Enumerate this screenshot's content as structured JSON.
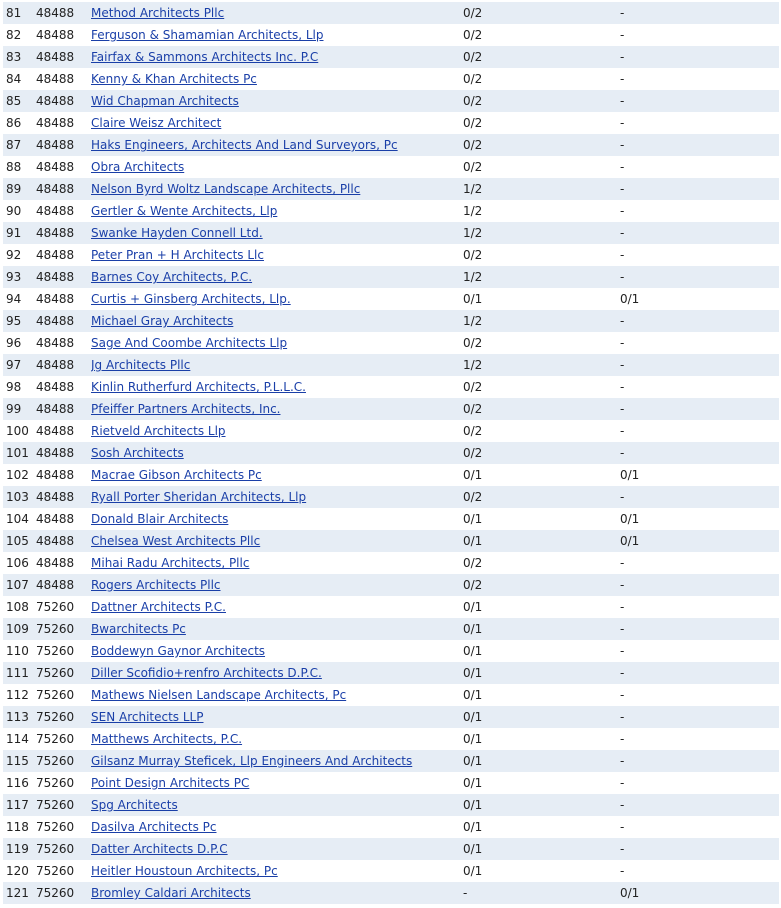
{
  "rows": [
    {
      "num": "81",
      "code": "48488",
      "name": "Method Architects Pllc",
      "a": "0/2",
      "b": "-"
    },
    {
      "num": "82",
      "code": "48488",
      "name": "Ferguson & Shamamian Architects, Llp",
      "a": "0/2",
      "b": "-"
    },
    {
      "num": "83",
      "code": "48488",
      "name": "Fairfax & Sammons Architects Inc. P.C",
      "a": "0/2",
      "b": "-"
    },
    {
      "num": "84",
      "code": "48488",
      "name": "Kenny & Khan Architects Pc",
      "a": "0/2",
      "b": "-"
    },
    {
      "num": "85",
      "code": "48488",
      "name": "Wid Chapman Architects",
      "a": "0/2",
      "b": "-"
    },
    {
      "num": "86",
      "code": "48488",
      "name": "Claire Weisz Architect",
      "a": "0/2",
      "b": "-"
    },
    {
      "num": "87",
      "code": "48488",
      "name": "Haks Engineers, Architects And Land Surveyors, Pc",
      "a": "0/2",
      "b": "-"
    },
    {
      "num": "88",
      "code": "48488",
      "name": "Obra Architects",
      "a": "0/2",
      "b": "-"
    },
    {
      "num": "89",
      "code": "48488",
      "name": "Nelson Byrd Woltz Landscape Architects, Pllc",
      "a": "1/2",
      "b": "-"
    },
    {
      "num": "90",
      "code": "48488",
      "name": "Gertler & Wente Architects, Llp",
      "a": "1/2",
      "b": "-"
    },
    {
      "num": "91",
      "code": "48488",
      "name": "Swanke Hayden Connell Ltd.",
      "a": "1/2",
      "b": "-"
    },
    {
      "num": "92",
      "code": "48488",
      "name": "Peter Pran + H Architects Llc",
      "a": "0/2",
      "b": "-"
    },
    {
      "num": "93",
      "code": "48488",
      "name": "Barnes Coy Architects, P.C.",
      "a": "1/2",
      "b": "-"
    },
    {
      "num": "94",
      "code": "48488",
      "name": "Curtis + Ginsberg Architects, Llp.",
      "a": "0/1",
      "b": "0/1"
    },
    {
      "num": "95",
      "code": "48488",
      "name": "Michael Gray Architects",
      "a": "1/2",
      "b": "-"
    },
    {
      "num": "96",
      "code": "48488",
      "name": "Sage And Coombe Architects Llp",
      "a": "0/2",
      "b": "-"
    },
    {
      "num": "97",
      "code": "48488",
      "name": "Jg Architects Pllc",
      "a": "1/2",
      "b": "-"
    },
    {
      "num": "98",
      "code": "48488",
      "name": "Kinlin Rutherfurd Architects, P.L.L.C.",
      "a": "0/2",
      "b": "-"
    },
    {
      "num": "99",
      "code": "48488",
      "name": "Pfeiffer Partners Architects, Inc.",
      "a": "0/2",
      "b": "-"
    },
    {
      "num": "100",
      "code": "48488",
      "name": "Rietveld Architects Llp",
      "a": "0/2",
      "b": "-"
    },
    {
      "num": "101",
      "code": "48488",
      "name": "Sosh Architects",
      "a": "0/2",
      "b": "-"
    },
    {
      "num": "102",
      "code": "48488",
      "name": "Macrae Gibson Architects Pc",
      "a": "0/1",
      "b": "0/1"
    },
    {
      "num": "103",
      "code": "48488",
      "name": "Ryall Porter Sheridan Architects, Llp",
      "a": "0/2",
      "b": "-"
    },
    {
      "num": "104",
      "code": "48488",
      "name": "Donald Blair Architects",
      "a": "0/1",
      "b": "0/1"
    },
    {
      "num": "105",
      "code": "48488",
      "name": "Chelsea West Architects Pllc",
      "a": "0/1",
      "b": "0/1"
    },
    {
      "num": "106",
      "code": "48488",
      "name": "Mihai Radu Architects, Pllc",
      "a": "0/2",
      "b": "-"
    },
    {
      "num": "107",
      "code": "48488",
      "name": "Rogers Architects Pllc",
      "a": "0/2",
      "b": "-"
    },
    {
      "num": "108",
      "code": "75260",
      "name": "Dattner Architects P.C.",
      "a": "0/1",
      "b": "-"
    },
    {
      "num": "109",
      "code": "75260",
      "name": "Bwarchitects Pc",
      "a": "0/1",
      "b": "-"
    },
    {
      "num": "110",
      "code": "75260",
      "name": "Boddewyn Gaynor Architects",
      "a": "0/1",
      "b": "-"
    },
    {
      "num": "111",
      "code": "75260",
      "name": "Diller Scofidio+renfro Architects D.P.C.",
      "a": "0/1",
      "b": "-"
    },
    {
      "num": "112",
      "code": "75260",
      "name": "Mathews Nielsen Landscape Architects, Pc",
      "a": "0/1",
      "b": "-"
    },
    {
      "num": "113",
      "code": "75260",
      "name": "SEN Architects LLP",
      "a": "0/1",
      "b": "-"
    },
    {
      "num": "114",
      "code": "75260",
      "name": "Matthews Architects, P.C.",
      "a": "0/1",
      "b": "-"
    },
    {
      "num": "115",
      "code": "75260",
      "name": "Gilsanz Murray Steficek, Llp Engineers And Architects",
      "a": "0/1",
      "b": "-"
    },
    {
      "num": "116",
      "code": "75260",
      "name": "Point Design Architects PC",
      "a": "0/1",
      "b": "-"
    },
    {
      "num": "117",
      "code": "75260",
      "name": "Spg Architects",
      "a": "0/1",
      "b": "-"
    },
    {
      "num": "118",
      "code": "75260",
      "name": "Dasilva Architects Pc",
      "a": "0/1",
      "b": "-"
    },
    {
      "num": "119",
      "code": "75260",
      "name": "Datter Architects D.P.C",
      "a": "0/1",
      "b": "-"
    },
    {
      "num": "120",
      "code": "75260",
      "name": "Heitler Houstoun Architects, Pc",
      "a": "0/1",
      "b": "-"
    },
    {
      "num": "121",
      "code": "75260",
      "name": "Bromley Caldari Architects",
      "a": "-",
      "b": "0/1"
    }
  ]
}
